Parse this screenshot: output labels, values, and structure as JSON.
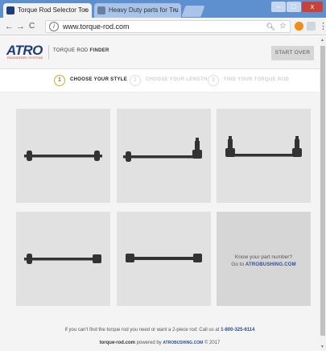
{
  "browser": {
    "tabs": [
      {
        "title": "Torque Rod Selector Too",
        "active": true
      },
      {
        "title": "Heavy Duty parts for Tru",
        "active": false
      }
    ],
    "address": "www.torque-rod.com",
    "nav": {
      "back": "←",
      "forward": "→",
      "reload": "C"
    },
    "tab_close_glyph": "×",
    "window_controls": {
      "minimize": "–",
      "maximize": "□",
      "close": "x"
    },
    "menu_glyph": "⋮",
    "icons": {
      "info": "i",
      "zoom": "🔍︎",
      "bookmark": "☆"
    }
  },
  "header": {
    "logo_text": "ATRO",
    "logo_sub": "ENGINEERED SYSTEMS",
    "tool_title_prefix": "TORQUE ROD",
    "tool_title_bold": "FINDER",
    "start_over": "START OVER"
  },
  "steps": [
    {
      "num": "1",
      "label": "CHOOSE YOUR STYLE",
      "active": true
    },
    {
      "num": "2",
      "label": "CHOOSE YOUR LENGTH",
      "active": false
    },
    {
      "num": "3",
      "label": "FIND YOUR TORQUE ROD",
      "active": false
    }
  ],
  "styles": [
    {
      "id": "straight-bushing-both"
    },
    {
      "id": "one-end-upright"
    },
    {
      "id": "both-ends-upright"
    },
    {
      "id": "straight-one-end-block"
    },
    {
      "id": "block-ends"
    }
  ],
  "cta": {
    "line1": "Know your part number?",
    "line2_prefix": "Go to",
    "link": "ATROBUSHING.COM"
  },
  "footer": {
    "help_text": "If you can't find the torque rod you need or want a 2-piece rod: Call us at",
    "phone": "1-800-325-6114",
    "powered_site": "torque-rod.com",
    "powered_mid": "powered by",
    "powered_link": "ATROBUSHING.COM",
    "copyright": "© 2017"
  },
  "colors": {
    "rod": "#333333",
    "link": "#2d4f9a",
    "active_step_ring": "#e0a320",
    "tab_strip": "#5e8fcf"
  }
}
